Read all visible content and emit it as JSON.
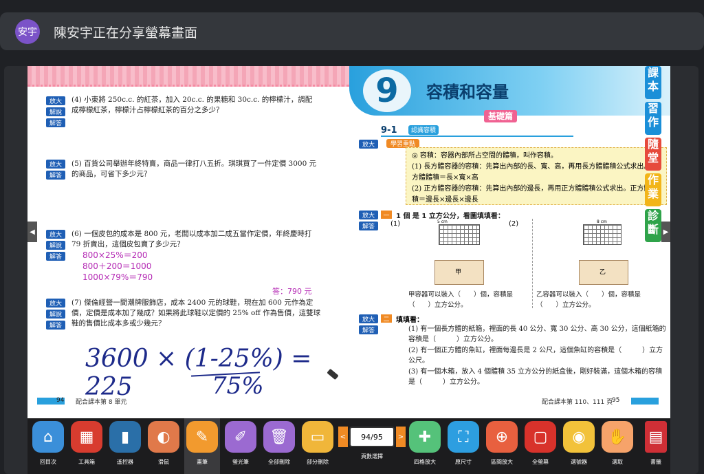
{
  "share": {
    "avatar_text": "安宇",
    "title": "陳安宇正在分享螢幕畫面"
  },
  "tags": {
    "zoom": "放大",
    "explain": "解說",
    "answer": "解答"
  },
  "left_page": {
    "q4": "(4) 小東將 250c.c. 的紅茶，加入 20c.c. 的果糖和 30c.c. 的檸檬汁，調配成檸檬紅茶，檸檬汁占檸檬紅茶的百分之多少？",
    "q5": "(5) 百貨公司舉辦年終特賣，商品一律打八五折。琪琪買了一件定價 3000 元的商品，可省下多少元？",
    "q6": "(6) 一個皮包的成本是 800 元，老闆以成本加二成五當作定價，年終慶時打 79 折賣出，這個皮包賣了多少元？",
    "q6_ans1": "800×25%＝200",
    "q6_ans2": "800＋200＝1000",
    "q6_ans3": "1000×79%＝790",
    "q6_final": "答：790 元",
    "q7": "(7) 傑倫經營一間潮牌服飾店，成本 2400 元的球鞋，現在加 600 元作為定價，定價是成本加了幾成？如果將此球鞋以定價的 25% off 作為售價，這雙球鞋的售價比成本多或少幾元？",
    "handwriting1": "3600 × (1-25%) = 225",
    "handwriting2": "75%",
    "page_num": "94",
    "footer": "配合課本第 8 單元"
  },
  "right_page": {
    "chapter_num": "9",
    "chapter_title": "容積和容量",
    "level": "基礎篇",
    "section": "9-1",
    "section_title": "認識容積",
    "kp_label": "學習重點",
    "kp1": "◎ 容積：容器內部所占空間的體積，叫作容積。",
    "kp2": "(1) 長方體容器的容積：先算出內部的長、寬、高，再用長方體體積公式求出。長方體體積＝長×寬×高",
    "kp3": "(2) 正方體容器的容積：先算出內部的邊長，再用正方體體積公式求出。正方體體積＝邊長×邊長×邊長",
    "ex1_title": "1 個 是 1 立方公分，看圖填填看：",
    "fig1": "(1)",
    "fig2": "(2)",
    "dim1": "5 cm",
    "dim2": "8 cm",
    "box1": "甲",
    "box2": "乙",
    "fill1": "甲容器可以裝入（　　）個，容積是（　　）立方公分。",
    "fill2": "乙容器可以裝入（　　）個，容積是（　　）立方公分。",
    "ex2_title": "填填看：",
    "ex2_1": "(1) 有一個長方體的紙箱，裡面的長 40 公分、寬 30 公分、高 30 公分，這個紙箱的容積是（　　　）立方公分。",
    "ex2_2": "(2) 有一個正方體的魚缸，裡面每邊長是 2 公尺，這個魚缸的容積是（　　　）立方公尺。",
    "ex2_3": "(3) 有一個木箱，放入 4 個體積 35 立方公分的紙盒後，剛好裝滿，這個木箱的容積是（　　　）立方公分。",
    "page_num": "95",
    "footer": "配合課本第 110、111 頁"
  },
  "side_tabs": [
    "課本",
    "習作",
    "隨堂",
    "作業",
    "診斷"
  ],
  "side_tab_colors": [
    "#1b8fd8",
    "#1b8fd8",
    "#e64a3c",
    "#f2b519",
    "#2fa34a"
  ],
  "toolbar": {
    "tools": [
      {
        "label": "回目次",
        "icon": "home-icon",
        "color": "#3b8fd9"
      },
      {
        "label": "工具箱",
        "icon": "toolbox-icon",
        "color": "#d83c2f"
      },
      {
        "label": "遙控器",
        "icon": "remote-icon",
        "color": "#2a6fa8"
      },
      {
        "label": "滑鼠",
        "icon": "mouse-icon",
        "color": "#e0794a"
      },
      {
        "label": "畫筆",
        "icon": "pen-icon",
        "color": "#f29a2e"
      },
      {
        "label": "螢光筆",
        "icon": "highlighter-icon",
        "color": "#9b6ad1"
      },
      {
        "label": "全部刪除",
        "icon": "trash-icon",
        "color": "#9b6ad1"
      },
      {
        "label": "部分刪除",
        "icon": "eraser-icon",
        "color": "#f0b63a"
      },
      {
        "label": "頁數選擇",
        "icon": "page-select-icon",
        "color": "#f08a24"
      },
      {
        "label": "四格放大",
        "icon": "grid-zoom-icon",
        "color": "#55c27a"
      },
      {
        "label": "原尺寸",
        "icon": "fit-icon",
        "color": "#2d9ee0"
      },
      {
        "label": "區間放大",
        "icon": "area-zoom-icon",
        "color": "#e8603f"
      },
      {
        "label": "全螢幕",
        "icon": "fullscreen-icon",
        "color": "#d8322b"
      },
      {
        "label": "選號器",
        "icon": "lottery-icon",
        "color": "#f2c23a"
      },
      {
        "label": "選取",
        "icon": "hand-icon",
        "color": "#f6a36a"
      },
      {
        "label": "書籤",
        "icon": "bookmark-icon",
        "color": "#cf2f36"
      }
    ],
    "page_value": "94/95"
  }
}
